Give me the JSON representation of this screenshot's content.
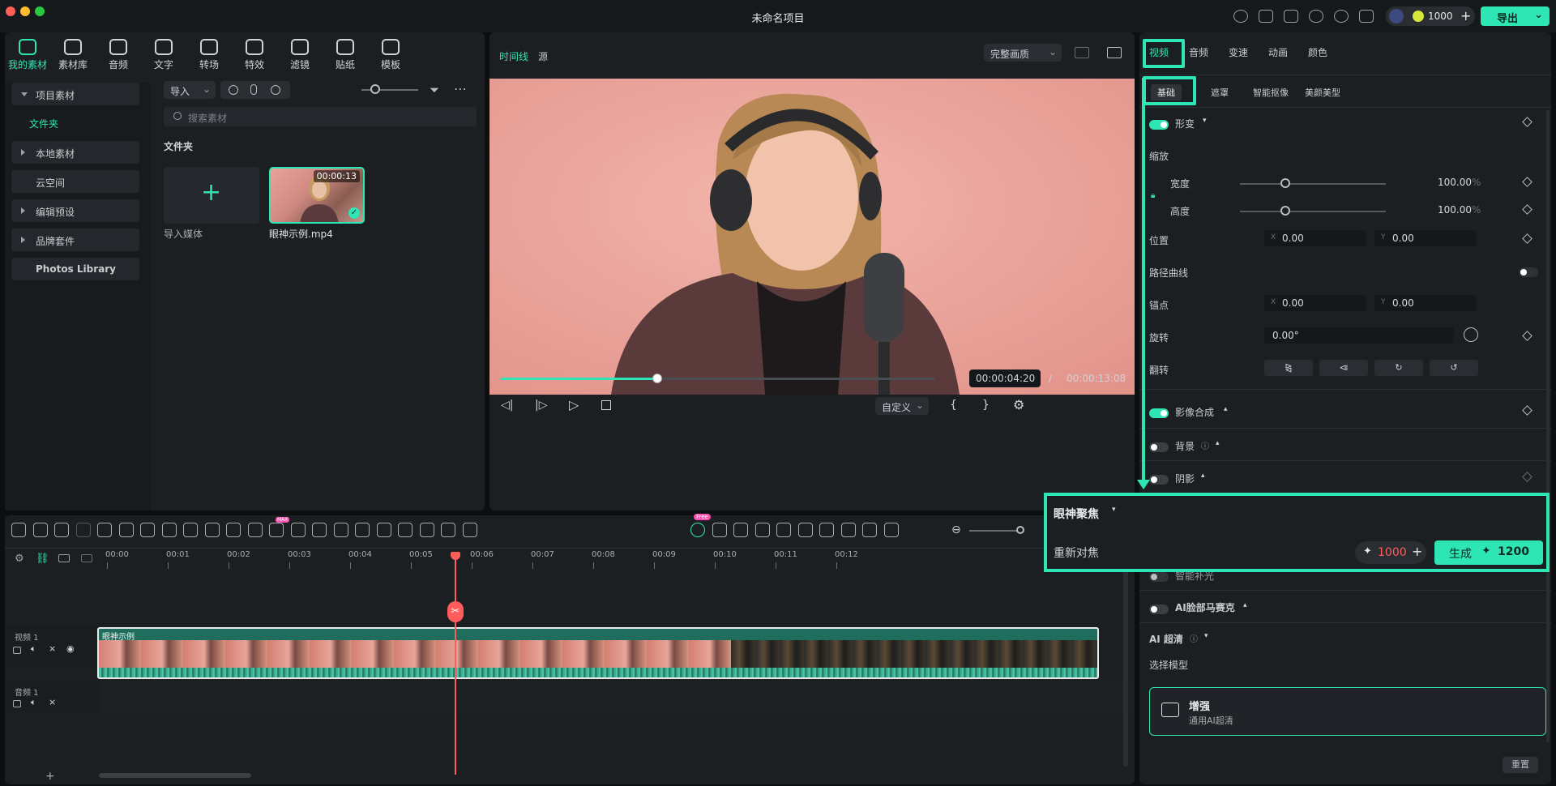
{
  "window": {
    "title": "未命名项目"
  },
  "header": {
    "credits": "1000",
    "export_label": "导出"
  },
  "colors": {
    "accent": "#2ee6b4",
    "playhead": "#ff5c5c",
    "panel": "#1c1f22"
  },
  "media_tabs": [
    {
      "label": "我的素材",
      "icon": "media-icon"
    },
    {
      "label": "素材库",
      "icon": "store-icon"
    },
    {
      "label": "音频",
      "icon": "music-icon"
    },
    {
      "label": "文字",
      "icon": "text-icon"
    },
    {
      "label": "转场",
      "icon": "transition-icon"
    },
    {
      "label": "特效",
      "icon": "effects-icon"
    },
    {
      "label": "滤镜",
      "icon": "filter-icon"
    },
    {
      "label": "贴纸",
      "icon": "sticker-icon"
    },
    {
      "label": "模板",
      "icon": "template-icon"
    }
  ],
  "sidebar": {
    "items": [
      "项目素材",
      "文件夹",
      "本地素材",
      "云空间",
      "编辑预设",
      "品牌套件",
      "Photos Library"
    ]
  },
  "library": {
    "import_label": "导入",
    "search_placeholder": "搜索素材",
    "folder_title": "文件夹",
    "import_media_label": "导入媒体",
    "clip_name": "眼神示例.mp4",
    "clip_duration": "00:00:13"
  },
  "preview": {
    "tab_timeline": "时间线",
    "tab_source": "源",
    "quality": "完整画质",
    "current_time": "00:00:04:20",
    "separator": "/",
    "total_time": "00:00:13:08",
    "zoom_label": "自定义",
    "brace_open": "{",
    "brace_close": "}",
    "progress": 0.36
  },
  "props": {
    "tabs": [
      "视频",
      "音频",
      "变速",
      "动画",
      "颜色"
    ],
    "subtabs": [
      "基础",
      "遮罩",
      "智能抠像",
      "美颜美型"
    ],
    "transform_label": "形变",
    "scale_label": "缩放",
    "width_label": "宽度",
    "width_value": "100.00",
    "width_unit": "%",
    "height_label": "高度",
    "height_value": "100.00",
    "height_unit": "%",
    "position_label": "位置",
    "pos_x_label": "X",
    "pos_x": "0.00",
    "pos_y_label": "Y",
    "pos_y": "0.00",
    "path_curve_label": "路径曲线",
    "anchor_label": "锚点",
    "anchor_x_label": "X",
    "anchor_x": "0.00",
    "anchor_y_label": "Y",
    "anchor_y": "0.00",
    "rotate_label": "旋转",
    "rotate_value": "0.00°",
    "flip_label": "翻转",
    "compositing_label": "影像合成",
    "background_label": "背景",
    "shadow_label": "阴影",
    "eye_focus_label": "眼神聚焦",
    "refocus_label": "重新对焦",
    "refocus_credits": "1000",
    "generate_label": "生成",
    "generate_credits": "1200",
    "smart_fill_label": "智能补光",
    "face_mosaic_label": "AI脸部马赛克",
    "ai_hd_label": "AI 超清",
    "select_model_label": "选择模型",
    "enhance_title": "增强",
    "enhance_subtitle": "通用AI超清",
    "reset_label": "重置"
  },
  "timeline": {
    "ruler": [
      "00:00",
      "00:01",
      "00:02",
      "00:03",
      "00:04",
      "00:05",
      "00:06",
      "00:07",
      "00:08",
      "00:09",
      "00:10",
      "00:11",
      "00:12"
    ],
    "video_track_label": "视频 1",
    "audio_track_label": "音频 1",
    "clip_label": "眼神示例",
    "add_track": "+",
    "free_badge": "Free",
    "max_badge": "MAX"
  }
}
